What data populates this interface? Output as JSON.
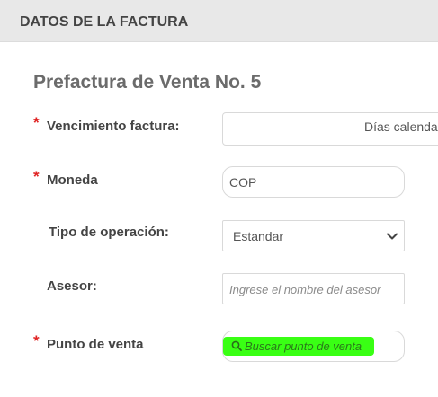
{
  "header": {
    "title": "DATOS DE LA FACTURA"
  },
  "document": {
    "title": "Prefactura de Venta No. 5"
  },
  "form": {
    "required_mark": "*",
    "due": {
      "label": "Vencimiento factura:",
      "value": "Días calenda"
    },
    "currency": {
      "label": "Moneda",
      "value": "COP"
    },
    "operation_type": {
      "label": "Tipo de operación:",
      "value": "Estandar"
    },
    "advisor": {
      "label": "Asesor:",
      "placeholder": "Ingrese el nombre del asesor"
    },
    "point_of_sale": {
      "label": "Punto de venta",
      "placeholder": "Buscar punto de venta"
    }
  },
  "colors": {
    "required": "#e02424",
    "highlight": "#39ff14",
    "header_bg": "#e8e8e8"
  },
  "icons": {
    "select": "chevron-down-icon",
    "search": "search-icon"
  }
}
